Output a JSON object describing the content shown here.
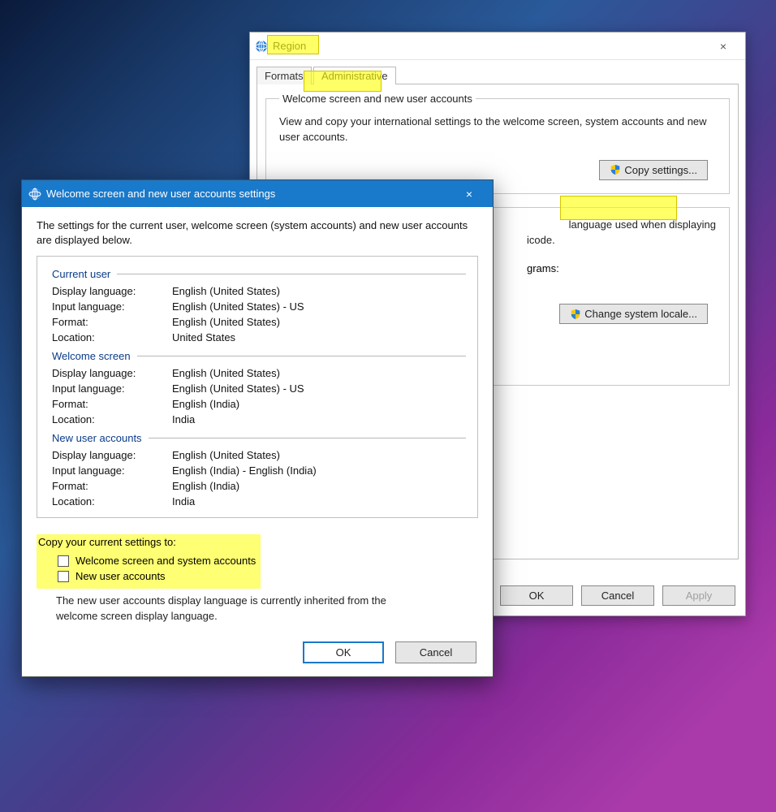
{
  "region_window": {
    "title": "Region",
    "close_label": "×",
    "tabs": {
      "formats": "Formats",
      "administrative": "Administrative"
    },
    "welcome_group": {
      "legend": "Welcome screen and new user accounts",
      "description": "View and copy your international settings to the welcome screen, system accounts and new user accounts.",
      "copy_button": "Copy settings..."
    },
    "locale_group": {
      "description_tail_1": "language used when displaying",
      "description_tail_2": "icode.",
      "label_tail": "grams:",
      "change_button": "Change system locale..."
    },
    "ok_label": "OK",
    "cancel_label": "Cancel",
    "apply_label": "Apply"
  },
  "modal": {
    "title": "Welcome screen and new user accounts settings",
    "close_label": "×",
    "intro": "The settings for the current user, welcome screen (system accounts) and new user accounts are displayed below.",
    "sections": {
      "current_user": {
        "heading": "Current user",
        "display_language_label": "Display language:",
        "display_language_value": "English (United States)",
        "input_language_label": "Input language:",
        "input_language_value": "English (United States) - US",
        "format_label": "Format:",
        "format_value": "English (United States)",
        "location_label": "Location:",
        "location_value": "United States"
      },
      "welcome_screen": {
        "heading": "Welcome screen",
        "display_language_label": "Display language:",
        "display_language_value": "English (United States)",
        "input_language_label": "Input language:",
        "input_language_value": "English (United States) - US",
        "format_label": "Format:",
        "format_value": "English (India)",
        "location_label": "Location:",
        "location_value": "India"
      },
      "new_user": {
        "heading": "New user accounts",
        "display_language_label": "Display language:",
        "display_language_value": "English (United States)",
        "input_language_label": "Input language:",
        "input_language_value": "English (India) - English (India)",
        "format_label": "Format:",
        "format_value": "English (India)",
        "location_label": "Location:",
        "location_value": "India"
      }
    },
    "copy_heading": "Copy your current settings to:",
    "checkbox_welcome": "Welcome screen and system accounts",
    "checkbox_newuser": "New user accounts",
    "inherit_text": "The new user accounts display language is currently inherited from the welcome screen display language.",
    "ok_label": "OK",
    "cancel_label": "Cancel"
  }
}
